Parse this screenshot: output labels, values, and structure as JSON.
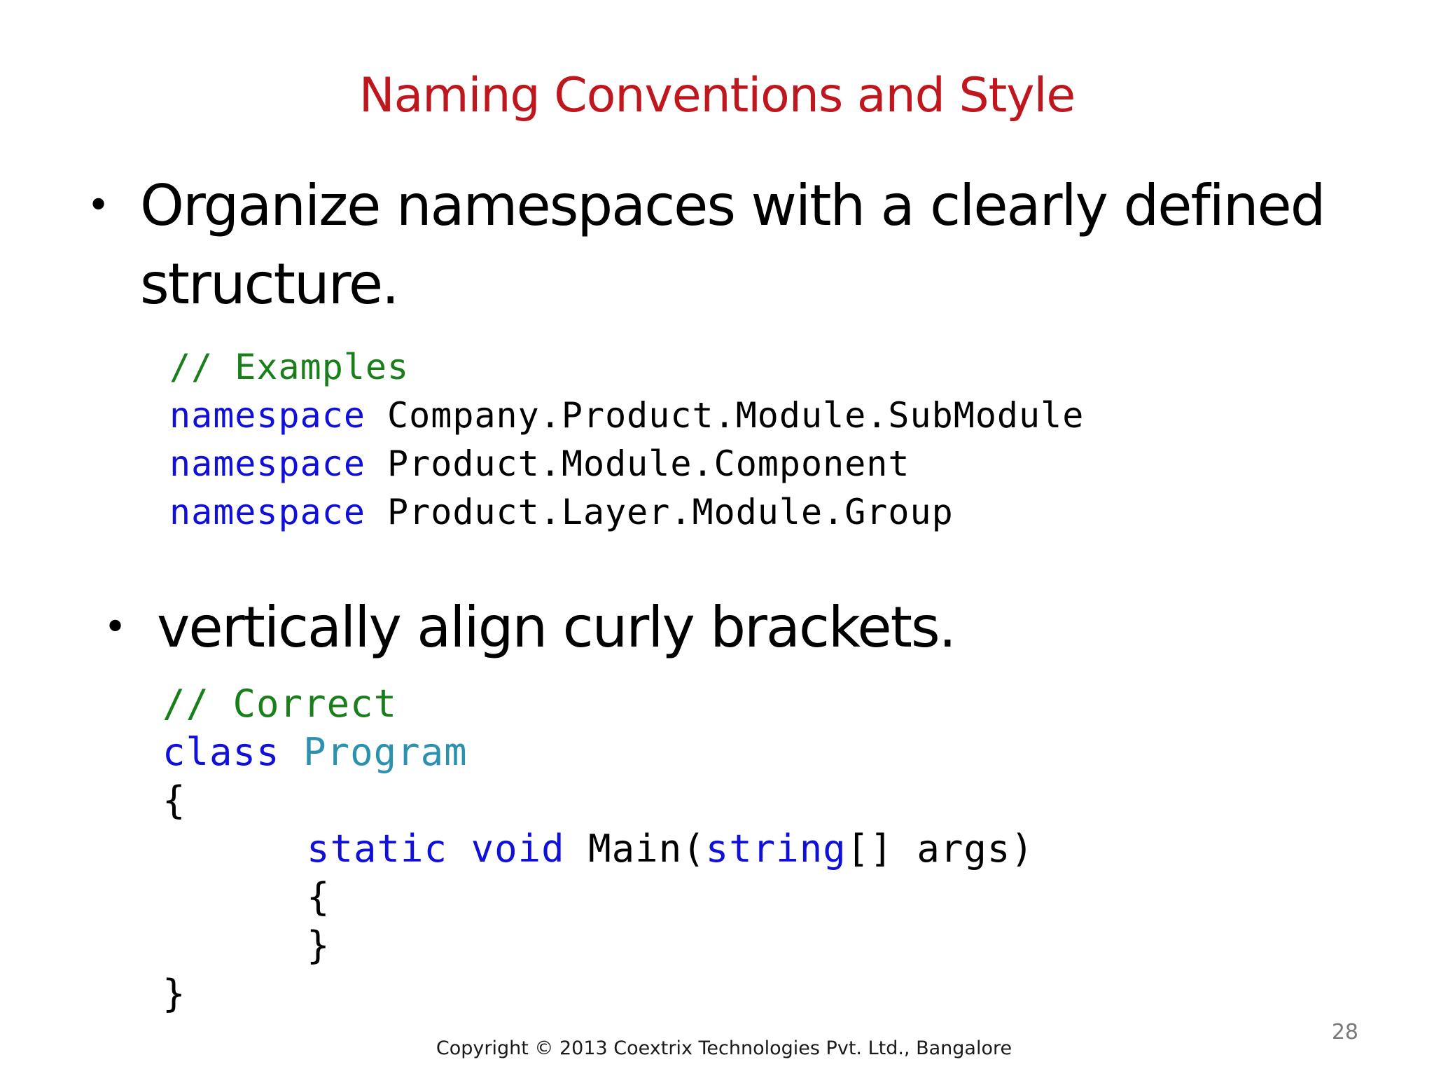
{
  "slide": {
    "title": "Naming Conventions and Style",
    "bullets": [
      {
        "marker": "•",
        "text": "Organize namespaces with a clearly defined structure."
      },
      {
        "marker": "•",
        "text": "vertically align curly brackets."
      }
    ],
    "code_namespaces": {
      "comment": "// Examples",
      "lines": [
        {
          "keyword": "namespace",
          "name": "Company.Product.Module.SubModule"
        },
        {
          "keyword": "namespace",
          "name": "Product.Module.Component"
        },
        {
          "keyword": "namespace",
          "name": "Product.Layer.Module.Group"
        }
      ]
    },
    "code_brackets": {
      "comment": "// Correct",
      "class_keyword": "class",
      "class_name": "Program",
      "open_brace": "{",
      "method_static": "static",
      "method_void": "void",
      "method_name": "Main(",
      "param_type": "string",
      "param_rest": "[] args)",
      "inner_open": "{",
      "inner_close": "}",
      "close_brace": "}"
    },
    "footer": "Copyright © 2013 Coextrix Technologies Pvt. Ltd., Bangalore",
    "page_number": "28"
  },
  "colors": {
    "title": "#c0161d",
    "comment": "#1a7f1a",
    "keyword": "#1010d8",
    "type": "#2b91af"
  }
}
